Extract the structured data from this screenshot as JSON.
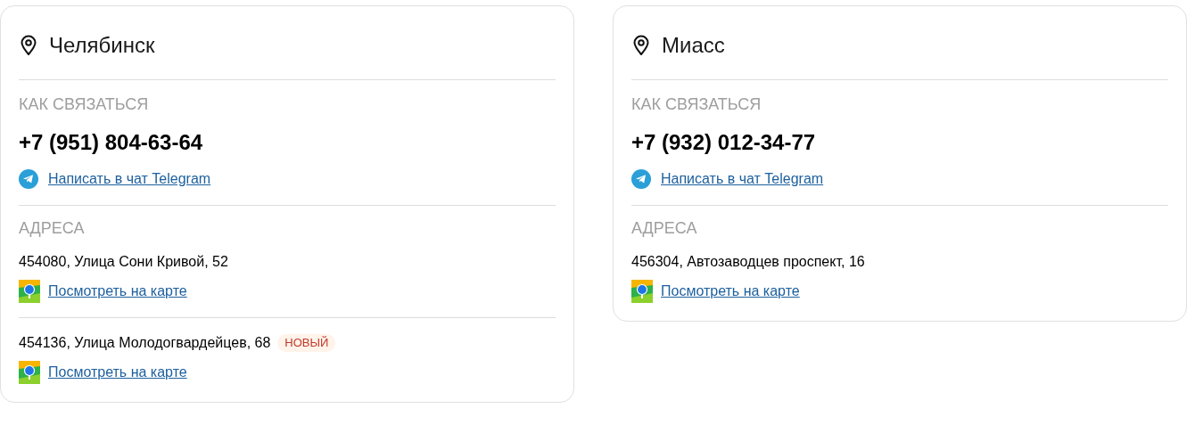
{
  "cards": [
    {
      "city": "Челябинск",
      "contact_heading": "КАК СВЯЗАТЬСЯ",
      "phone": "+7 (951) 804-63-64",
      "telegram_link": "Написать в чат Telegram",
      "addresses_heading": "АДРЕСА",
      "addresses": [
        {
          "address": "454080, Улица Сони Кривой, 52",
          "map_link": "Посмотреть на карте"
        },
        {
          "address": "454136, Улица Молодогвардейцев, 68",
          "badge": "НОВЫЙ",
          "map_link": "Посмотреть на карте"
        }
      ]
    },
    {
      "city": "Миасс",
      "contact_heading": "КАК СВЯЗАТЬСЯ",
      "phone": "+7 (932) 012-34-77",
      "telegram_link": "Написать в чат Telegram",
      "addresses_heading": "АДРЕСА",
      "addresses": [
        {
          "address": "456304, Автозаводцев проспект, 16",
          "map_link": "Посмотреть на карте"
        }
      ]
    }
  ]
}
